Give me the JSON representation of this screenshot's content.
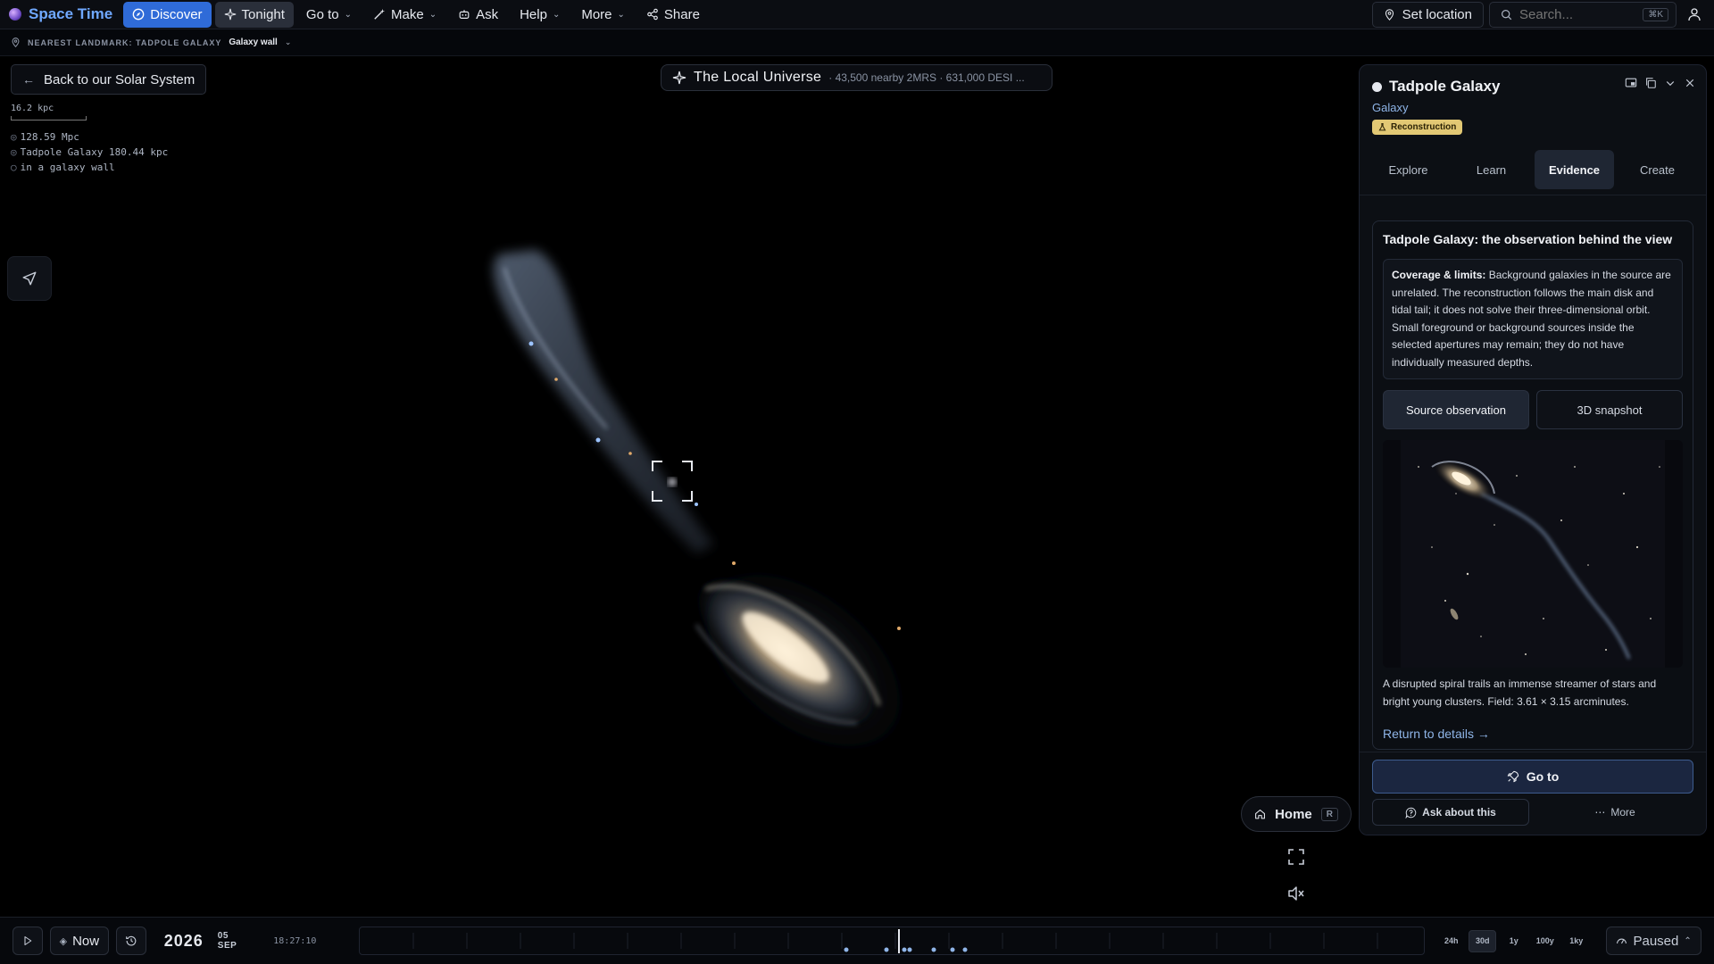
{
  "topbar": {
    "brand": "Space Time",
    "nav": [
      {
        "label": "Discover",
        "icon": "compass-icon"
      },
      {
        "label": "Tonight",
        "icon": "sparkle-icon"
      },
      {
        "label": "Go to",
        "icon": ""
      },
      {
        "label": "Make",
        "icon": "wand-icon"
      },
      {
        "label": "Ask",
        "icon": "robot-icon"
      },
      {
        "label": "Help",
        "icon": ""
      },
      {
        "label": "More",
        "icon": ""
      },
      {
        "label": "Share",
        "icon": "share-icon"
      }
    ],
    "set_location": "Set location",
    "search_placeholder": "Search...",
    "search_shortcut": "⌘K"
  },
  "landmark": {
    "label": "NEAREST LANDMARK: TADPOLE GALAXY",
    "value": "Galaxy wall"
  },
  "overlay": {
    "back_label": "Back to our Solar System",
    "scale_label": "16.2 kpc",
    "info_lines": [
      "128.59 Mpc",
      "Tadpole Galaxy 180.44 kpc",
      "in a galaxy wall"
    ]
  },
  "title_pill": {
    "title": "The Local Universe",
    "subtitle": "· 43,500 nearby 2MRS · 631,000 DESI ..."
  },
  "controls": {
    "home_label": "Home",
    "home_shortcut": "R"
  },
  "panel": {
    "title": "Tadpole Galaxy",
    "kind": "Galaxy",
    "badge": "Reconstruction",
    "tabs": [
      "Explore",
      "Learn",
      "Evidence",
      "Create"
    ],
    "active_tab": "Evidence",
    "evidence_title": "Tadpole Galaxy: the observation behind the view",
    "coverage_label": "Coverage & limits:",
    "coverage_text": "Background galaxies in the source are unrelated. The reconstruction follows the main disk and tidal tail; it does not solve their three-dimensional orbit. Small foreground or background sources inside the selected apertures may remain; they do not have individually measured depths.",
    "source_buttons": [
      "Source observation",
      "3D snapshot"
    ],
    "caption": "A disrupted spiral trails an immense streamer of stars and bright young clusters. Field: 3.61 × 3.15 arcminutes.",
    "return_link": "Return to details →",
    "goto_label": "Go to",
    "ask_label": "Ask about this",
    "more_label": "More"
  },
  "timebar": {
    "now_label": "Now",
    "year": "2026",
    "date": "05 SEP",
    "clock": "18:27:10",
    "ranges": [
      "24h",
      "30d",
      "1y",
      "100y",
      "1ky"
    ],
    "active_range": "30d",
    "paused_label": "Paused"
  },
  "colors": {
    "accent": "#2f6bd8",
    "brand": "#6fa8ff",
    "badge": "#e2c874",
    "link": "#8fb5e8"
  }
}
